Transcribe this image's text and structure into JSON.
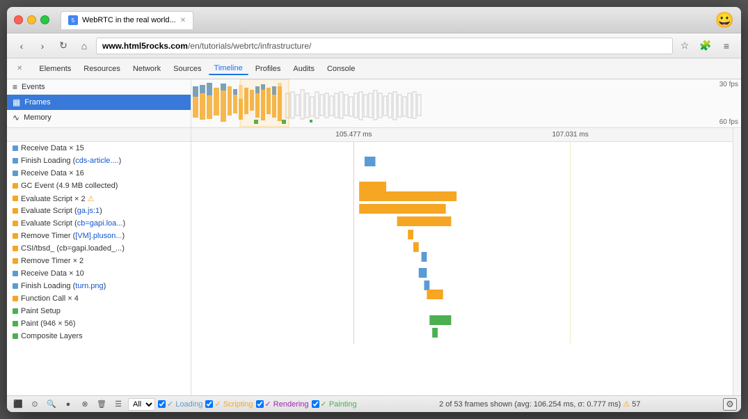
{
  "browser": {
    "tab_title": "WebRTC in the real world...",
    "url_prefix": "www.html5rocks.com",
    "url_path": "/en/tutorials/webrtc/infrastructure/",
    "url_display": "www.html5rocks.com/en/tutorials/webrtc/infrastructure/"
  },
  "devtools": {
    "tabs": [
      "Elements",
      "Resources",
      "Network",
      "Sources",
      "Timeline",
      "Profiles",
      "Audits",
      "Console"
    ],
    "active_tab": "Timeline",
    "left_panel": {
      "items": [
        {
          "id": "events",
          "label": "Events",
          "icon": "≡"
        },
        {
          "id": "frames",
          "label": "Frames",
          "icon": "▦",
          "selected": true
        },
        {
          "id": "memory",
          "label": "Memory",
          "icon": "∿"
        }
      ]
    },
    "fps": {
      "label_30": "30 fps",
      "label_60": "60 fps"
    },
    "timeline_markers": [
      {
        "label": "105.477 ms",
        "pct": 30
      },
      {
        "label": "107.031 ms",
        "pct": 70
      }
    ],
    "events": [
      {
        "color": "blue",
        "name": "Receive Data × 15",
        "link": null
      },
      {
        "color": "blue",
        "name": "Finish Loading (cds-article....",
        "link": "cds-article"
      },
      {
        "color": "blue",
        "name": "Receive Data × 16",
        "link": null
      },
      {
        "color": "orange",
        "name": "GC Event (4.9 MB collected)",
        "link": null
      },
      {
        "color": "orange",
        "name": "Evaluate Script × 2",
        "link": null,
        "warn": true
      },
      {
        "color": "orange",
        "name": "Evaluate Script (ga.js:1)",
        "link": "ga.js:1"
      },
      {
        "color": "orange",
        "name": "Evaluate Script (cb=gapi.loa...",
        "link": "cb=gapi.loa"
      },
      {
        "color": "orange",
        "name": "Remove Timer ([VM].pluson...",
        "link": "[VM].pluson"
      },
      {
        "color": "orange",
        "name": "CSI/tbsd_ (cb=gapi.loaded_...",
        "link": null
      },
      {
        "color": "orange",
        "name": "Remove Timer × 2",
        "link": null
      },
      {
        "color": "blue",
        "name": "Receive Data × 10",
        "link": null
      },
      {
        "color": "blue",
        "name": "Finish Loading (turn.png)",
        "link": "turn.png"
      },
      {
        "color": "orange",
        "name": "Function Call × 4",
        "link": null
      },
      {
        "color": "green",
        "name": "Paint Setup",
        "link": null
      },
      {
        "color": "green",
        "name": "Paint (946 × 56)",
        "link": null
      },
      {
        "color": "green",
        "name": "Composite Layers",
        "link": null
      }
    ],
    "status_bar": {
      "filter_options": [
        "All"
      ],
      "checkboxes": [
        {
          "label": "Loading",
          "checked": true,
          "color": "#5b9bd5"
        },
        {
          "label": "Scripting",
          "checked": true,
          "color": "#f5a623"
        },
        {
          "label": "Rendering",
          "checked": true,
          "color": "#9c27b0"
        },
        {
          "label": "Painting",
          "checked": true,
          "color": "#4caf50"
        }
      ],
      "status_text": "2 of 53 frames shown (avg: 106.254 ms, σ: 0.777 ms)",
      "warn_count": "57"
    }
  }
}
